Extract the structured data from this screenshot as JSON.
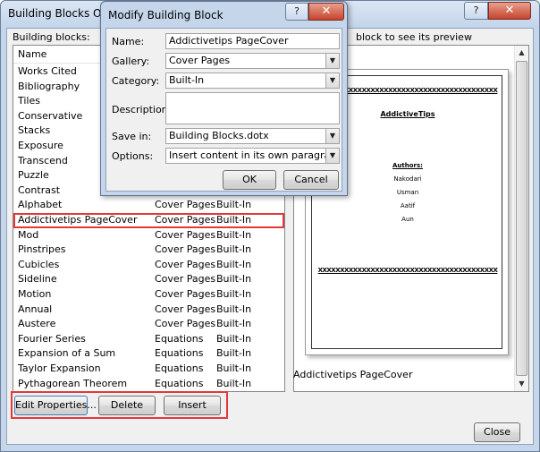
{
  "main_window": {
    "title": "Building Blocks Organi",
    "help_glyph": "?",
    "close_glyph": "✕",
    "blocks_label": "Building blocks:",
    "preview_label": "block to see its preview"
  },
  "list": {
    "headers": {
      "name": "Name"
    },
    "rows": [
      {
        "name": "Works Cited",
        "gallery": "",
        "category": ""
      },
      {
        "name": "Bibliography",
        "gallery": "",
        "category": ""
      },
      {
        "name": "Tiles",
        "gallery": "",
        "category": ""
      },
      {
        "name": "Conservative",
        "gallery": "",
        "category": ""
      },
      {
        "name": "Stacks",
        "gallery": "",
        "category": ""
      },
      {
        "name": "Exposure",
        "gallery": "",
        "category": ""
      },
      {
        "name": "Transcend",
        "gallery": "",
        "category": ""
      },
      {
        "name": "Puzzle",
        "gallery": "",
        "category": ""
      },
      {
        "name": "Contrast",
        "gallery": "",
        "category": ""
      },
      {
        "name": "Alphabet",
        "gallery": "Cover Pages",
        "category": "Built-In"
      },
      {
        "name": "Addictivetips PageCover",
        "gallery": "Cover Pages",
        "category": "Built-In"
      },
      {
        "name": "Mod",
        "gallery": "Cover Pages",
        "category": "Built-In"
      },
      {
        "name": "Pinstripes",
        "gallery": "Cover Pages",
        "category": "Built-In"
      },
      {
        "name": "Cubicles",
        "gallery": "Cover Pages",
        "category": "Built-In"
      },
      {
        "name": "Sideline",
        "gallery": "Cover Pages",
        "category": "Built-In"
      },
      {
        "name": "Motion",
        "gallery": "Cover Pages",
        "category": "Built-In"
      },
      {
        "name": "Annual",
        "gallery": "Cover Pages",
        "category": "Built-In"
      },
      {
        "name": "Austere",
        "gallery": "Cover Pages",
        "category": "Built-In"
      },
      {
        "name": "Fourier Series",
        "gallery": "Equations",
        "category": "Built-In"
      },
      {
        "name": "Expansion of a Sum",
        "gallery": "Equations",
        "category": "Built-In"
      },
      {
        "name": "Taylor Expansion",
        "gallery": "Equations",
        "category": "Built-In"
      },
      {
        "name": "Pythagorean Theorem",
        "gallery": "Equations",
        "category": "Built-In"
      }
    ],
    "selected_index": 10
  },
  "preview": {
    "line_top": "XXXXXXXXXXXXXXXXXXXXXXXXXXXXXXXXXXXXXXXXX",
    "title": "AddictiveTips",
    "authors_heading": "Authors:",
    "authors": [
      "Nakodari",
      "Usman",
      "Aatif",
      "Aun"
    ],
    "line_bottom": "XXXXXXXXXXXXXXXXXXXXXXXXXXXXXXXXXXXXXXXXX",
    "caption": "Addictivetips PageCover"
  },
  "buttons": {
    "edit_properties": "Edit Properties...",
    "delete": "Delete",
    "insert": "Insert",
    "close": "Close"
  },
  "modify_dialog": {
    "title": "Modify Building Block",
    "help_glyph": "?",
    "close_glyph": "✕",
    "name_label": "Name:",
    "name_value": "Addictivetips PageCover",
    "gallery_label": "Gallery:",
    "gallery_value": "Cover Pages",
    "category_label": "Category:",
    "category_value": "Built-In",
    "description_label": "Description:",
    "description_value": "",
    "save_in_label": "Save in:",
    "save_in_value": "Building Blocks.dotx",
    "options_label": "Options:",
    "options_value": "Insert content in its own paragraph",
    "ok": "OK",
    "cancel": "Cancel",
    "dropdown_glyph": "▼"
  },
  "colors": {
    "highlight": "#e23a3a",
    "frame": "#c5d6eb"
  }
}
